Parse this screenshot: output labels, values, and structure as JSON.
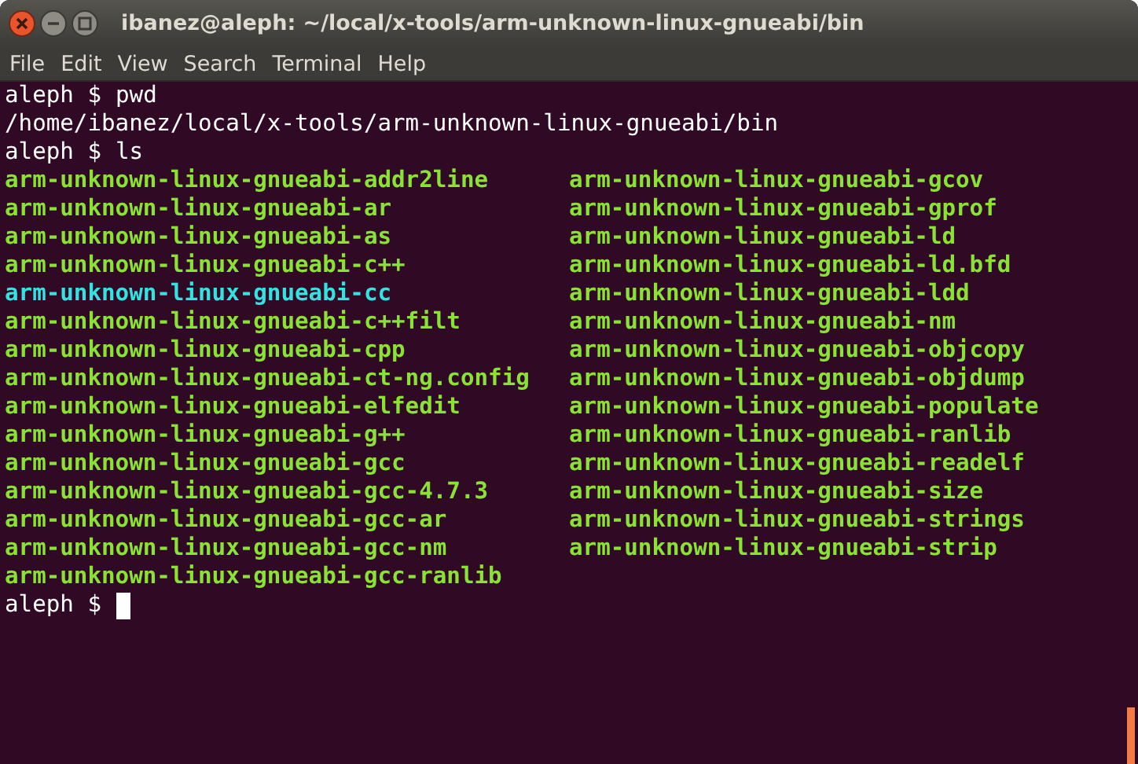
{
  "window": {
    "title": "ibanez@aleph: ~/local/x-tools/arm-unknown-linux-gnueabi/bin"
  },
  "menu": [
    "File",
    "Edit",
    "View",
    "Search",
    "Terminal",
    "Help"
  ],
  "terminal": {
    "lines": [
      {
        "kind": "prompt",
        "prompt": "aleph $",
        "command": "pwd"
      },
      {
        "kind": "output",
        "text": "/home/ibanez/local/x-tools/arm-unknown-linux-gnueabi/bin"
      },
      {
        "kind": "prompt",
        "prompt": "aleph $",
        "command": "ls"
      },
      {
        "kind": "listing",
        "entries": [
          {
            "name": "arm-unknown-linux-gnueabi-addr2line",
            "color": "#8ae234"
          },
          {
            "name": "arm-unknown-linux-gnueabi-ar",
            "color": "#8ae234"
          },
          {
            "name": "arm-unknown-linux-gnueabi-as",
            "color": "#8ae234"
          },
          {
            "name": "arm-unknown-linux-gnueabi-c++",
            "color": "#8ae234"
          },
          {
            "name": "arm-unknown-linux-gnueabi-cc",
            "color": "#34e2e2"
          },
          {
            "name": "arm-unknown-linux-gnueabi-c++filt",
            "color": "#8ae234"
          },
          {
            "name": "arm-unknown-linux-gnueabi-cpp",
            "color": "#8ae234"
          },
          {
            "name": "arm-unknown-linux-gnueabi-ct-ng.config",
            "color": "#8ae234"
          },
          {
            "name": "arm-unknown-linux-gnueabi-elfedit",
            "color": "#8ae234"
          },
          {
            "name": "arm-unknown-linux-gnueabi-g++",
            "color": "#8ae234"
          },
          {
            "name": "arm-unknown-linux-gnueabi-gcc",
            "color": "#8ae234"
          },
          {
            "name": "arm-unknown-linux-gnueabi-gcc-4.7.3",
            "color": "#8ae234"
          },
          {
            "name": "arm-unknown-linux-gnueabi-gcc-ar",
            "color": "#8ae234"
          },
          {
            "name": "arm-unknown-linux-gnueabi-gcc-nm",
            "color": "#8ae234"
          },
          {
            "name": "arm-unknown-linux-gnueabi-gcc-ranlib",
            "color": "#8ae234"
          },
          {
            "name": "arm-unknown-linux-gnueabi-gcov",
            "color": "#8ae234"
          },
          {
            "name": "arm-unknown-linux-gnueabi-gprof",
            "color": "#8ae234"
          },
          {
            "name": "arm-unknown-linux-gnueabi-ld",
            "color": "#8ae234"
          },
          {
            "name": "arm-unknown-linux-gnueabi-ld.bfd",
            "color": "#8ae234"
          },
          {
            "name": "arm-unknown-linux-gnueabi-ldd",
            "color": "#8ae234"
          },
          {
            "name": "arm-unknown-linux-gnueabi-nm",
            "color": "#8ae234"
          },
          {
            "name": "arm-unknown-linux-gnueabi-objcopy",
            "color": "#8ae234"
          },
          {
            "name": "arm-unknown-linux-gnueabi-objdump",
            "color": "#8ae234"
          },
          {
            "name": "arm-unknown-linux-gnueabi-populate",
            "color": "#8ae234"
          },
          {
            "name": "arm-unknown-linux-gnueabi-ranlib",
            "color": "#8ae234"
          },
          {
            "name": "arm-unknown-linux-gnueabi-readelf",
            "color": "#8ae234"
          },
          {
            "name": "arm-unknown-linux-gnueabi-size",
            "color": "#8ae234"
          },
          {
            "name": "arm-unknown-linux-gnueabi-strings",
            "color": "#8ae234"
          },
          {
            "name": "arm-unknown-linux-gnueabi-strip",
            "color": "#8ae234"
          }
        ]
      },
      {
        "kind": "prompt",
        "prompt": "aleph $",
        "cursor": true
      }
    ]
  }
}
